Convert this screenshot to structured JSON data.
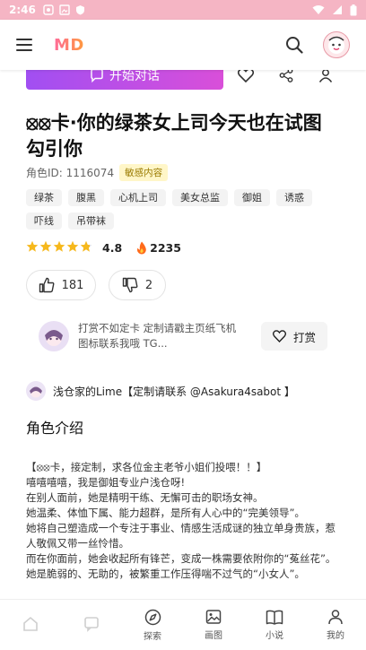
{
  "status_bar": {
    "time": "2:46"
  },
  "app": {
    "logo": "MD"
  },
  "actions": {
    "start_chat_label": "开始对话"
  },
  "character": {
    "title": "⦻⦻卡·你的绿茶女上司今天也在试图勾引你",
    "id_label": "角色ID: 1116074",
    "sensitive_badge": "敏感内容",
    "tags": [
      "绿茶",
      "腹黑",
      "心机上司",
      "美女总监",
      "御姐",
      "诱惑",
      "吓线",
      "吊带袜"
    ],
    "rating": 4.8,
    "rating_text": "4.8",
    "heat": "2235",
    "likes": "181",
    "dislikes": "2"
  },
  "reward": {
    "text": "打赏不如定卡 定制请戳主页纸飞机图标联系我哦 TG...",
    "button_label": "打赏"
  },
  "author": {
    "name": "浅仓家的Lime【定制请联系 @Asakura4sabot 】"
  },
  "section": {
    "title": "角色介绍"
  },
  "description": [
    "【⦻⦻卡，接定制，求各位金主老爷小姐们投喂！！】",
    "嘻嘻嘻嘻，我是御姐专业户浅仓呀!",
    "在别人面前，她是精明干练、无懈可击的职场女神。",
    "她温柔、体恤下属、能力超群，是所有人心中的“完美领导”。",
    "她将自己塑造成一个专注于事业、情感生活成谜的独立单身贵族，惹人敬佩又带一丝怜惜。",
    "而在你面前，她会收起所有锋芒，变成一株需要依附你的“菟丝花”。",
    "她是脆弱的、无助的，被繁重工作压得喘不过气的“小女人”。"
  ],
  "bottom_nav": [
    {
      "label": "",
      "icon": "home-icon",
      "faded": true
    },
    {
      "label": "",
      "icon": "chat-icon",
      "faded": true
    },
    {
      "label": "探索",
      "icon": "compass-icon",
      "faded": false
    },
    {
      "label": "画图",
      "icon": "image-icon",
      "faded": false
    },
    {
      "label": "小说",
      "icon": "book-icon",
      "faded": false
    },
    {
      "label": "我的",
      "icon": "user-icon",
      "faded": false
    }
  ],
  "colors": {
    "status_bar": "#f5b5c4",
    "start_gradient_from": "#a14ff2",
    "start_gradient_to": "#d94fd9",
    "star": "#f6b81c",
    "fire": "#ff6a1a"
  }
}
